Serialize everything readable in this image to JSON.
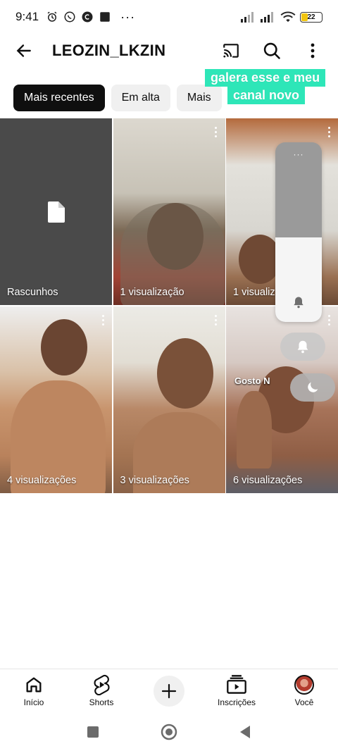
{
  "status_bar": {
    "time": "9:41",
    "battery": "22",
    "overflow": "···"
  },
  "header": {
    "title": "LEOZIN_LKZIN"
  },
  "chips": [
    {
      "label": "Mais recentes",
      "active": true
    },
    {
      "label": "Em alta",
      "active": false
    },
    {
      "label": "Mais",
      "active": false
    }
  ],
  "caption": {
    "line1": "galera esse e meu",
    "line2": "canal novo"
  },
  "videos": [
    {
      "label": "Rascunhos",
      "type": "drafts"
    },
    {
      "label": "1 visualização"
    },
    {
      "label": "1 visualiz"
    },
    {
      "label": "4 visualizações"
    },
    {
      "label": "3 visualizações"
    },
    {
      "label": "6 visualizações",
      "overlay_text": "Gosto     N"
    }
  ],
  "volume_panel": {
    "dots": "···",
    "level": 0.47
  },
  "bottom_nav": [
    {
      "label": "Início",
      "icon": "home-icon"
    },
    {
      "label": "Shorts",
      "icon": "shorts-icon"
    },
    {
      "label": "",
      "icon": "create-icon"
    },
    {
      "label": "Inscrições",
      "icon": "subscriptions-icon"
    },
    {
      "label": "Você",
      "icon": "avatar"
    }
  ],
  "colors": {
    "caption_bg": "#2ee6b8",
    "chip_active": "#0f0f0f",
    "drafts_bg": "#4a4a4a"
  }
}
